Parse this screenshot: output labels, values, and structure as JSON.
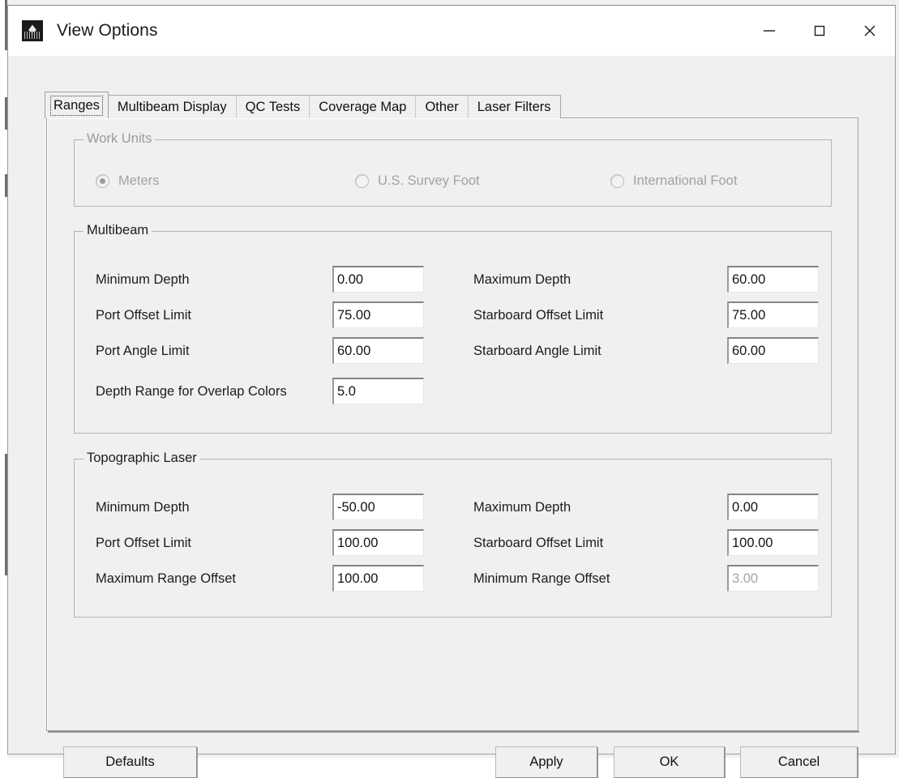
{
  "window": {
    "title": "View Options",
    "icon": "app-logo-icon",
    "controls": {
      "minimize": "minimize-icon",
      "maximize": "maximize-icon",
      "close": "close-icon"
    }
  },
  "tabs": [
    {
      "label": "Ranges",
      "selected": true
    },
    {
      "label": "Multibeam Display",
      "selected": false
    },
    {
      "label": "QC Tests",
      "selected": false
    },
    {
      "label": "Coverage Map",
      "selected": false
    },
    {
      "label": "Other",
      "selected": false
    },
    {
      "label": "Laser Filters",
      "selected": false
    }
  ],
  "work_units": {
    "title": "Work Units",
    "enabled": false,
    "options": [
      {
        "label": "Meters",
        "selected": true
      },
      {
        "label": "U.S. Survey Foot",
        "selected": false
      },
      {
        "label": "International Foot",
        "selected": false
      }
    ]
  },
  "multibeam": {
    "title": "Multibeam",
    "fields": [
      {
        "label": "Minimum Depth",
        "value": "0.00",
        "disabled": false
      },
      {
        "label": "Maximum Depth",
        "value": "60.00",
        "disabled": false
      },
      {
        "label": "Port Offset Limit",
        "value": "75.00",
        "disabled": false
      },
      {
        "label": "Starboard Offset Limit",
        "value": "75.00",
        "disabled": false
      },
      {
        "label": "Port Angle Limit",
        "value": "60.00",
        "disabled": false
      },
      {
        "label": "Starboard Angle Limit",
        "value": "60.00",
        "disabled": false
      },
      {
        "label": "Depth Range for Overlap Colors",
        "value": "5.0",
        "disabled": false
      }
    ]
  },
  "topographic_laser": {
    "title": "Topographic Laser",
    "fields": [
      {
        "label": "Minimum Depth",
        "value": "-50.00",
        "disabled": false
      },
      {
        "label": "Maximum Depth",
        "value": "0.00",
        "disabled": false
      },
      {
        "label": "Port Offset Limit",
        "value": "100.00",
        "disabled": false
      },
      {
        "label": "Starboard Offset Limit",
        "value": "100.00",
        "disabled": false
      },
      {
        "label": "Maximum Range Offset",
        "value": "100.00",
        "disabled": false
      },
      {
        "label": "Minimum Range Offset",
        "value": "3.00",
        "disabled": true
      }
    ]
  },
  "buttons": {
    "defaults": "Defaults",
    "apply": "Apply",
    "ok": "OK",
    "cancel": "Cancel"
  },
  "colors": {
    "dialog_bg": "#f0f0f0",
    "titlebar_bg": "#ffffff",
    "text": "#1c1c1c",
    "disabled_text": "#a2a2a2",
    "field_bg": "#ffffff",
    "border": "#b4b4b4"
  }
}
